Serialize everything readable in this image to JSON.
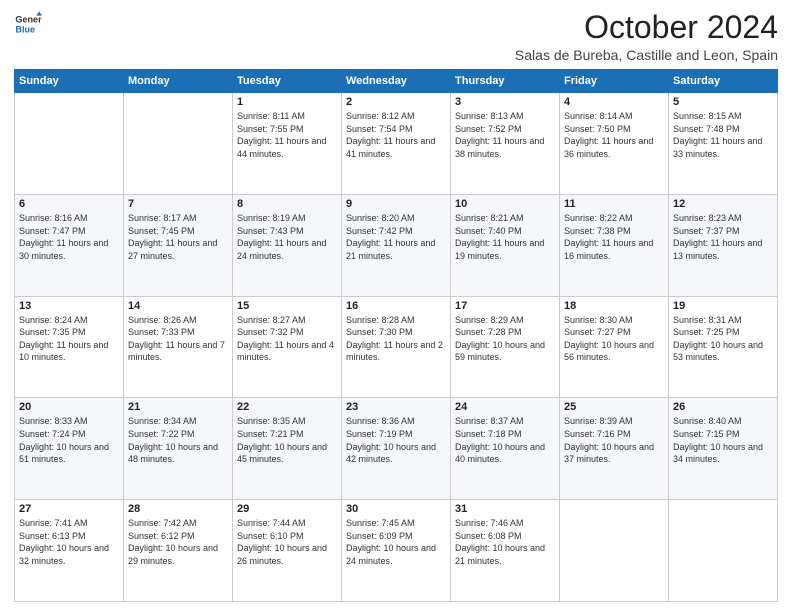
{
  "logo": {
    "line1": "General",
    "line2": "Blue"
  },
  "header": {
    "month": "October 2024",
    "location": "Salas de Bureba, Castille and Leon, Spain"
  },
  "weekdays": [
    "Sunday",
    "Monday",
    "Tuesday",
    "Wednesday",
    "Thursday",
    "Friday",
    "Saturday"
  ],
  "weeks": [
    [
      {
        "day": "",
        "sunrise": "",
        "sunset": "",
        "daylight": ""
      },
      {
        "day": "",
        "sunrise": "",
        "sunset": "",
        "daylight": ""
      },
      {
        "day": "1",
        "sunrise": "Sunrise: 8:11 AM",
        "sunset": "Sunset: 7:55 PM",
        "daylight": "Daylight: 11 hours and 44 minutes."
      },
      {
        "day": "2",
        "sunrise": "Sunrise: 8:12 AM",
        "sunset": "Sunset: 7:54 PM",
        "daylight": "Daylight: 11 hours and 41 minutes."
      },
      {
        "day": "3",
        "sunrise": "Sunrise: 8:13 AM",
        "sunset": "Sunset: 7:52 PM",
        "daylight": "Daylight: 11 hours and 38 minutes."
      },
      {
        "day": "4",
        "sunrise": "Sunrise: 8:14 AM",
        "sunset": "Sunset: 7:50 PM",
        "daylight": "Daylight: 11 hours and 36 minutes."
      },
      {
        "day": "5",
        "sunrise": "Sunrise: 8:15 AM",
        "sunset": "Sunset: 7:48 PM",
        "daylight": "Daylight: 11 hours and 33 minutes."
      }
    ],
    [
      {
        "day": "6",
        "sunrise": "Sunrise: 8:16 AM",
        "sunset": "Sunset: 7:47 PM",
        "daylight": "Daylight: 11 hours and 30 minutes."
      },
      {
        "day": "7",
        "sunrise": "Sunrise: 8:17 AM",
        "sunset": "Sunset: 7:45 PM",
        "daylight": "Daylight: 11 hours and 27 minutes."
      },
      {
        "day": "8",
        "sunrise": "Sunrise: 8:19 AM",
        "sunset": "Sunset: 7:43 PM",
        "daylight": "Daylight: 11 hours and 24 minutes."
      },
      {
        "day": "9",
        "sunrise": "Sunrise: 8:20 AM",
        "sunset": "Sunset: 7:42 PM",
        "daylight": "Daylight: 11 hours and 21 minutes."
      },
      {
        "day": "10",
        "sunrise": "Sunrise: 8:21 AM",
        "sunset": "Sunset: 7:40 PM",
        "daylight": "Daylight: 11 hours and 19 minutes."
      },
      {
        "day": "11",
        "sunrise": "Sunrise: 8:22 AM",
        "sunset": "Sunset: 7:38 PM",
        "daylight": "Daylight: 11 hours and 16 minutes."
      },
      {
        "day": "12",
        "sunrise": "Sunrise: 8:23 AM",
        "sunset": "Sunset: 7:37 PM",
        "daylight": "Daylight: 11 hours and 13 minutes."
      }
    ],
    [
      {
        "day": "13",
        "sunrise": "Sunrise: 8:24 AM",
        "sunset": "Sunset: 7:35 PM",
        "daylight": "Daylight: 11 hours and 10 minutes."
      },
      {
        "day": "14",
        "sunrise": "Sunrise: 8:26 AM",
        "sunset": "Sunset: 7:33 PM",
        "daylight": "Daylight: 11 hours and 7 minutes."
      },
      {
        "day": "15",
        "sunrise": "Sunrise: 8:27 AM",
        "sunset": "Sunset: 7:32 PM",
        "daylight": "Daylight: 11 hours and 4 minutes."
      },
      {
        "day": "16",
        "sunrise": "Sunrise: 8:28 AM",
        "sunset": "Sunset: 7:30 PM",
        "daylight": "Daylight: 11 hours and 2 minutes."
      },
      {
        "day": "17",
        "sunrise": "Sunrise: 8:29 AM",
        "sunset": "Sunset: 7:28 PM",
        "daylight": "Daylight: 10 hours and 59 minutes."
      },
      {
        "day": "18",
        "sunrise": "Sunrise: 8:30 AM",
        "sunset": "Sunset: 7:27 PM",
        "daylight": "Daylight: 10 hours and 56 minutes."
      },
      {
        "day": "19",
        "sunrise": "Sunrise: 8:31 AM",
        "sunset": "Sunset: 7:25 PM",
        "daylight": "Daylight: 10 hours and 53 minutes."
      }
    ],
    [
      {
        "day": "20",
        "sunrise": "Sunrise: 8:33 AM",
        "sunset": "Sunset: 7:24 PM",
        "daylight": "Daylight: 10 hours and 51 minutes."
      },
      {
        "day": "21",
        "sunrise": "Sunrise: 8:34 AM",
        "sunset": "Sunset: 7:22 PM",
        "daylight": "Daylight: 10 hours and 48 minutes."
      },
      {
        "day": "22",
        "sunrise": "Sunrise: 8:35 AM",
        "sunset": "Sunset: 7:21 PM",
        "daylight": "Daylight: 10 hours and 45 minutes."
      },
      {
        "day": "23",
        "sunrise": "Sunrise: 8:36 AM",
        "sunset": "Sunset: 7:19 PM",
        "daylight": "Daylight: 10 hours and 42 minutes."
      },
      {
        "day": "24",
        "sunrise": "Sunrise: 8:37 AM",
        "sunset": "Sunset: 7:18 PM",
        "daylight": "Daylight: 10 hours and 40 minutes."
      },
      {
        "day": "25",
        "sunrise": "Sunrise: 8:39 AM",
        "sunset": "Sunset: 7:16 PM",
        "daylight": "Daylight: 10 hours and 37 minutes."
      },
      {
        "day": "26",
        "sunrise": "Sunrise: 8:40 AM",
        "sunset": "Sunset: 7:15 PM",
        "daylight": "Daylight: 10 hours and 34 minutes."
      }
    ],
    [
      {
        "day": "27",
        "sunrise": "Sunrise: 7:41 AM",
        "sunset": "Sunset: 6:13 PM",
        "daylight": "Daylight: 10 hours and 32 minutes."
      },
      {
        "day": "28",
        "sunrise": "Sunrise: 7:42 AM",
        "sunset": "Sunset: 6:12 PM",
        "daylight": "Daylight: 10 hours and 29 minutes."
      },
      {
        "day": "29",
        "sunrise": "Sunrise: 7:44 AM",
        "sunset": "Sunset: 6:10 PM",
        "daylight": "Daylight: 10 hours and 26 minutes."
      },
      {
        "day": "30",
        "sunrise": "Sunrise: 7:45 AM",
        "sunset": "Sunset: 6:09 PM",
        "daylight": "Daylight: 10 hours and 24 minutes."
      },
      {
        "day": "31",
        "sunrise": "Sunrise: 7:46 AM",
        "sunset": "Sunset: 6:08 PM",
        "daylight": "Daylight: 10 hours and 21 minutes."
      },
      {
        "day": "",
        "sunrise": "",
        "sunset": "",
        "daylight": ""
      },
      {
        "day": "",
        "sunrise": "",
        "sunset": "",
        "daylight": ""
      }
    ]
  ]
}
